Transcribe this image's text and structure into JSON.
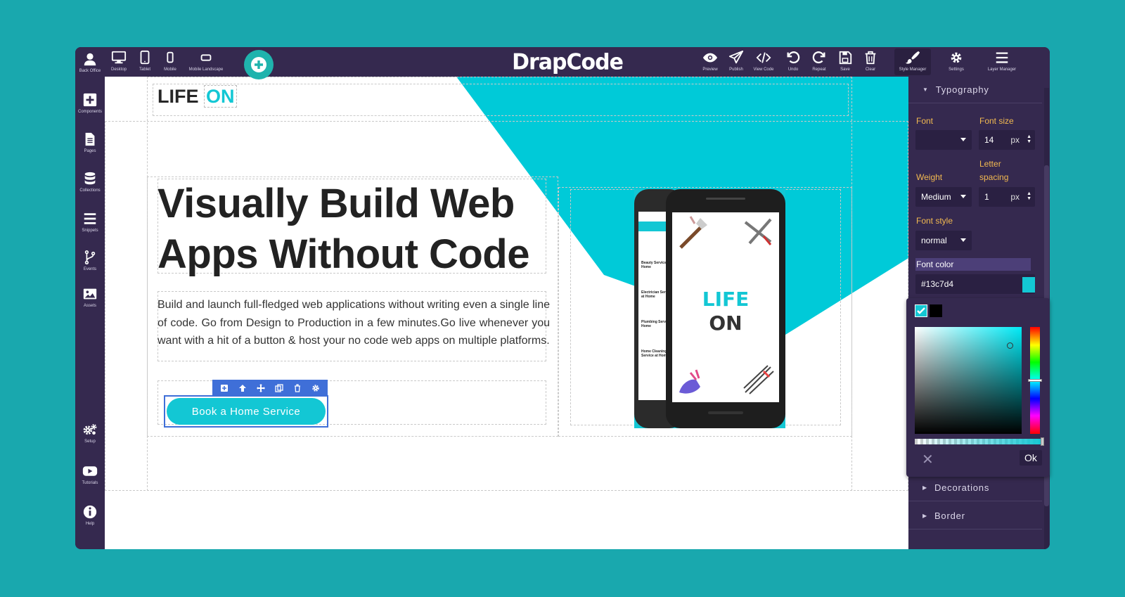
{
  "toolbar": {
    "back_office": "Back Office",
    "desktop": "Desktop",
    "tablet": "Tablet",
    "mobile": "Mobile",
    "mobile_landscape": "Mobile Landscape",
    "logo": "DrapCode",
    "preview": "Preview",
    "publish": "Publish",
    "view_code": "View Code",
    "undo": "Undo",
    "repeat": "Repeat",
    "save": "Save",
    "clear": "Clear",
    "style_manager": "Style Manager",
    "settings": "Settings",
    "layer_manager": "Layer Manager"
  },
  "sidebar": {
    "components": "Components",
    "pages": "Pages",
    "collections": "Collections",
    "snippets": "Snippets",
    "events": "Events",
    "assets": "Assets",
    "setup": "Setup",
    "tutorials": "Tutorials",
    "help": "Help"
  },
  "canvas": {
    "brand_main": "LIFE",
    "brand_accent": "ON",
    "hero_title": "Visually Build Web Apps Without Code",
    "hero_desc": "Build and launch full-fledged web applications without writing even a single line of code. Go from Design to Production in a few minutes.Go live whenever you want with a hit of a button & host your no code web apps on multiple platforms.",
    "cta_label": "Book a Home Service",
    "phone_logo_1": "LIFE",
    "phone_logo_2": "ON",
    "phone_items": [
      "Beauty Service at Home",
      "Electrician Service at Home",
      "Plumbing Service at Home",
      "Home Cleaning Service at Home"
    ]
  },
  "style_panel": {
    "typography": "Typography",
    "font_label": "Font",
    "font_value": "",
    "font_size_label": "Font size",
    "font_size_value": "14",
    "font_size_unit": "px",
    "weight_label": "Weight",
    "weight_value": "Medium",
    "letter_spacing_label": "Letter spacing",
    "letter_spacing_value": "1",
    "letter_spacing_unit": "px",
    "font_style_label": "Font style",
    "font_style_value": "normal",
    "font_color_label": "Font color",
    "font_color_value": "#13c7d4",
    "decorations": "Decorations",
    "border": "Border"
  },
  "color_picker": {
    "ok": "Ok",
    "hue_fraction": 0.5,
    "alpha_fraction": 1.0,
    "swatches": [
      "#13c7d4",
      "#000000"
    ]
  },
  "colors": {
    "app_bg": "#35294f",
    "accent": "#13c7d4",
    "page_bg": "#19a8ae",
    "selection": "#3f6fd8"
  }
}
